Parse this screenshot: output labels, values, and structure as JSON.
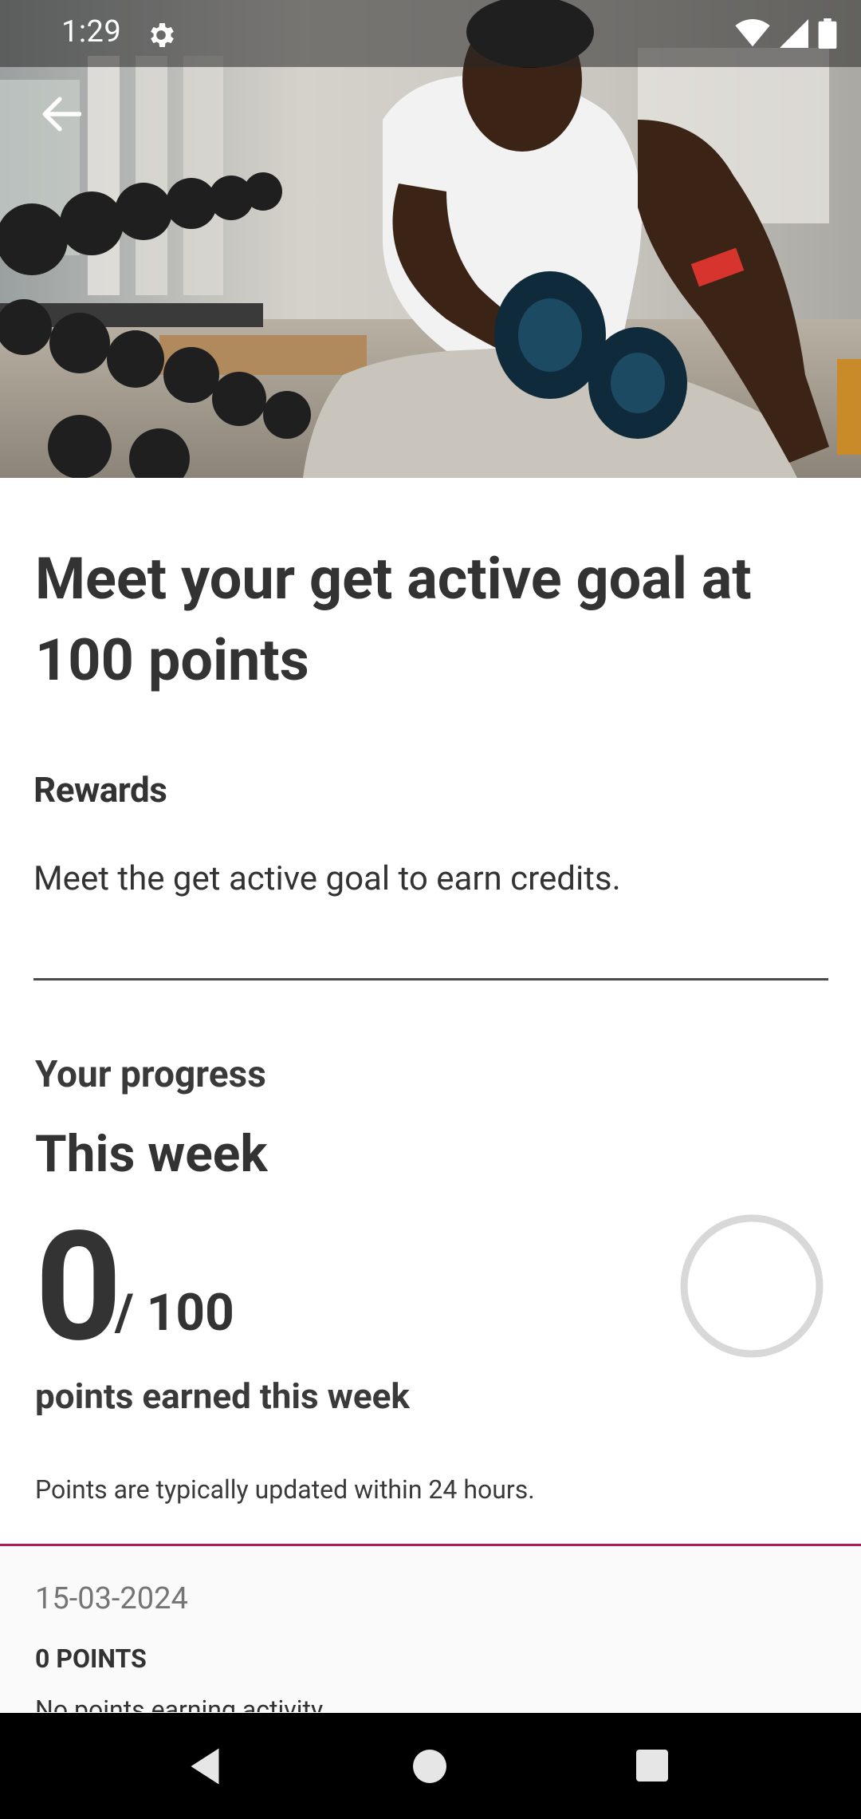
{
  "status_bar": {
    "time": "1:29",
    "icons": [
      "gear-icon",
      "wifi-icon",
      "cellular-signal-icon",
      "battery-icon"
    ]
  },
  "hero": {
    "image": "man-lifting-dumbbell-in-gym-photo",
    "back_icon": "arrow-left-icon"
  },
  "goal": {
    "title": "Meet your get active goal at 100 points"
  },
  "rewards": {
    "heading": "Rewards",
    "text": "Meet the get active goal to earn credits."
  },
  "progress": {
    "label": "Your progress",
    "period": "This week",
    "points": "0",
    "total": "/ 100",
    "fraction": 0,
    "caption": "points earned this week",
    "note": "Points are typically updated within 24 hours."
  },
  "history": {
    "date": "15-03-2024",
    "points": "0 POINTS",
    "activity": "No points earning activity"
  },
  "colors": {
    "accent": "#b0195a",
    "ring": "#d8d8d8",
    "text": "#333333",
    "muted": "#757575"
  },
  "nav_bar": {
    "icons": [
      "back-triangle-icon",
      "home-circle-icon",
      "recents-square-icon"
    ]
  }
}
